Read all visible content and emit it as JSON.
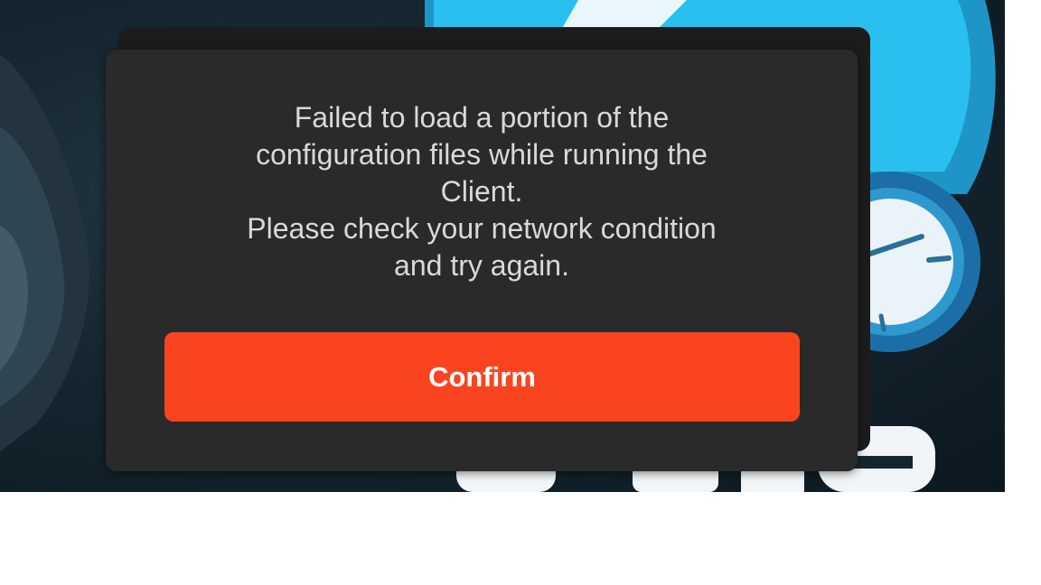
{
  "dialog": {
    "message_lines": [
      "Failed to load a portion of the",
      "configuration files while running the",
      "Client.",
      "Please check your network condition",
      "and try again."
    ],
    "confirm_label": "Confirm"
  },
  "colors": {
    "dialog_background": "#2a2a2a",
    "confirm_button": "#fa4420",
    "message_text": "#d9d9d9",
    "logo_blue": "#1fb4e6"
  },
  "icons": {
    "background_logo": "blue-speed-gauge-logo"
  }
}
